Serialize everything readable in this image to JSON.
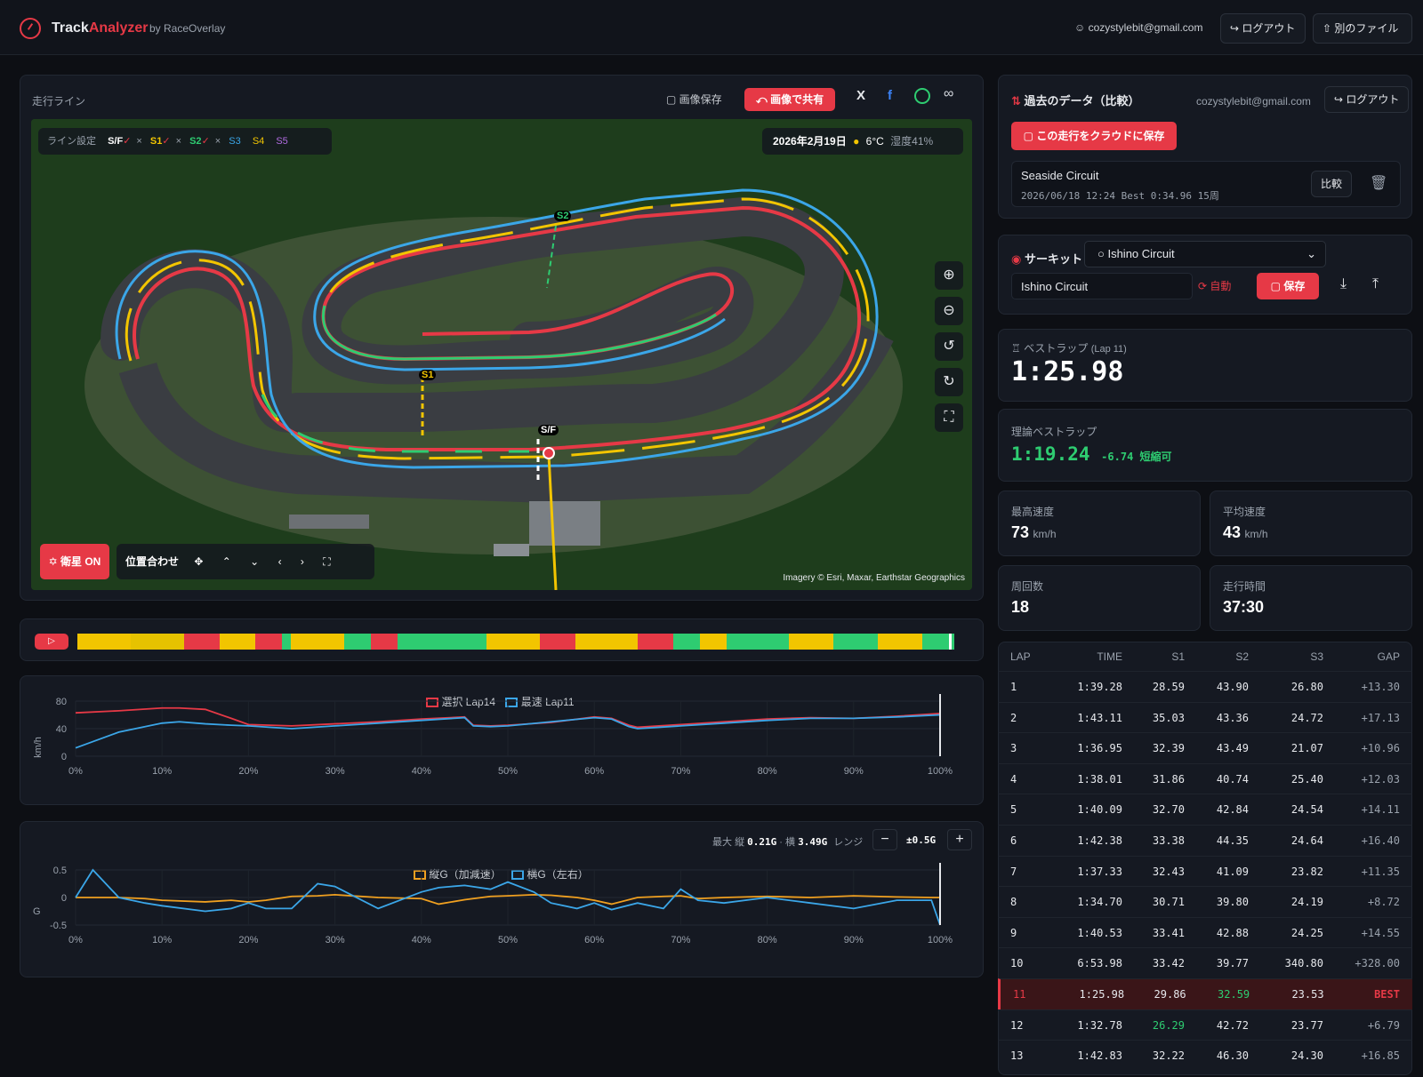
{
  "header": {
    "brand_a": "Track",
    "brand_b": "Analyzer",
    "by": "by RaceOverlay",
    "user": "cozystylebit@gmail.com",
    "logout": "ログアウト",
    "other_file": "別のファイル"
  },
  "map_panel": {
    "title": "走行ライン",
    "save_image": "画像保存",
    "share_image": "画像で共有",
    "line_settings": "ライン設定",
    "lines": [
      "S/F",
      "S1",
      "S2",
      "S3",
      "S4",
      "S5"
    ],
    "date": "2026年2月19日",
    "temp": "6°C",
    "humidity": "湿度41%",
    "sector_labels": [
      "S1",
      "S2",
      "S/F"
    ],
    "satellite": "衛星 ON",
    "align": "位置合わせ",
    "attribution": "Imagery © Esri, Maxar, Earthstar Geographics"
  },
  "speed_chart": {
    "legend_a": "選択 Lap14",
    "legend_b": "最速 Lap11",
    "ylabel": "km/h",
    "yticks": [
      "80",
      "40",
      "0"
    ],
    "xticks": [
      "0%",
      "10%",
      "20%",
      "30%",
      "40%",
      "50%",
      "60%",
      "70%",
      "80%",
      "90%",
      "100%"
    ]
  },
  "g_chart": {
    "max_label": "最大",
    "max_long_label": "縦",
    "max_long": "0.21G",
    "max_lat_label": "横",
    "max_lat": "3.49G",
    "range_label": "レンジ",
    "range": "±0.5G",
    "legend_a": "縦G（加減速）",
    "legend_b": "横G（左右）",
    "ylabel": "G",
    "yticks": [
      "0.5",
      "0",
      "-0.5"
    ],
    "xticks": [
      "0%",
      "10%",
      "20%",
      "30%",
      "40%",
      "50%",
      "60%",
      "70%",
      "80%",
      "90%",
      "100%"
    ]
  },
  "past": {
    "title": "過去のデータ（比較）",
    "user": "cozystylebit@gmail.com",
    "logout": "ログアウト",
    "save_cloud": "この走行をクラウドに保存",
    "entry_name": "Seaside Circuit",
    "entry_meta": "2026/06/18 12:24  Best 0:34.96  15周",
    "compare": "比較"
  },
  "circuit": {
    "label": "サーキット",
    "selected": "Ishino Circuit",
    "name_value": "Ishino Circuit",
    "auto": "自動",
    "save": "保存"
  },
  "best_lap": {
    "label": "ベストラップ",
    "sub": "(Lap 11)",
    "value": "1:25.98"
  },
  "theory": {
    "label": "理論ベストラップ",
    "value": "1:19.24",
    "delta": "-6.74 短縮可"
  },
  "stats": {
    "top_speed_label": "最高速度",
    "top_speed": "73",
    "top_speed_unit": "km/h",
    "avg_speed_label": "平均速度",
    "avg_speed": "43",
    "avg_speed_unit": "km/h",
    "laps_label": "周回数",
    "laps": "18",
    "time_label": "走行時間",
    "time": "37:30"
  },
  "laps_table": {
    "headers": [
      "LAP",
      "TIME",
      "S1",
      "S2",
      "S3",
      "GAP"
    ],
    "rows": [
      [
        "1",
        "1:39.28",
        "28.59",
        "43.90",
        "26.80",
        "+13.30"
      ],
      [
        "2",
        "1:43.11",
        "35.03",
        "43.36",
        "24.72",
        "+17.13"
      ],
      [
        "3",
        "1:36.95",
        "32.39",
        "43.49",
        "21.07",
        "+10.96"
      ],
      [
        "4",
        "1:38.01",
        "31.86",
        "40.74",
        "25.40",
        "+12.03"
      ],
      [
        "5",
        "1:40.09",
        "32.70",
        "42.84",
        "24.54",
        "+14.11"
      ],
      [
        "6",
        "1:42.38",
        "33.38",
        "44.35",
        "24.64",
        "+16.40"
      ],
      [
        "7",
        "1:37.33",
        "32.43",
        "41.09",
        "23.82",
        "+11.35"
      ],
      [
        "8",
        "1:34.70",
        "30.71",
        "39.80",
        "24.19",
        "+8.72"
      ],
      [
        "9",
        "1:40.53",
        "33.41",
        "42.88",
        "24.25",
        "+14.55"
      ],
      [
        "10",
        "6:53.98",
        "33.42",
        "39.77",
        "340.80",
        "+328.00"
      ],
      [
        "11",
        "1:25.98",
        "29.86",
        "32.59",
        "23.53",
        "BEST"
      ],
      [
        "12",
        "1:32.78",
        "26.29",
        "42.72",
        "23.77",
        "+6.79"
      ],
      [
        "13",
        "1:42.83",
        "32.22",
        "46.30",
        "24.30",
        "+16.85"
      ]
    ]
  },
  "chart_data": [
    {
      "type": "line",
      "x": [
        0,
        5,
        10,
        12,
        15,
        18,
        20,
        25,
        30,
        35,
        40,
        45,
        46,
        48,
        50,
        55,
        60,
        62,
        64,
        65,
        70,
        75,
        80,
        85,
        90,
        95,
        100
      ],
      "series": [
        {
          "name": "選択 Lap14",
          "values": [
            63,
            66,
            70,
            70,
            68,
            55,
            46,
            44,
            47,
            50,
            54,
            57,
            45,
            44,
            45,
            49,
            57,
            55,
            45,
            42,
            46,
            50,
            54,
            56,
            55,
            58,
            62
          ]
        },
        {
          "name": "最速 Lap11",
          "values": [
            12,
            35,
            48,
            50,
            47,
            45,
            44,
            40,
            44,
            48,
            52,
            56,
            44,
            43,
            44,
            50,
            56,
            54,
            43,
            40,
            44,
            48,
            52,
            55,
            55,
            57,
            60
          ]
        }
      ],
      "ylim": [
        0,
        80
      ],
      "ylabel": "km/h"
    },
    {
      "type": "line",
      "x": [
        0,
        2,
        5,
        8,
        10,
        15,
        18,
        20,
        22,
        25,
        28,
        30,
        35,
        40,
        42,
        45,
        48,
        50,
        53,
        55,
        58,
        60,
        62,
        65,
        68,
        70,
        72,
        75,
        80,
        85,
        90,
        95,
        99,
        100
      ],
      "series": [
        {
          "name": "縦G（加減速）",
          "values": [
            0,
            0,
            0,
            -0.02,
            -0.05,
            -0.08,
            -0.05,
            -0.08,
            -0.05,
            0.02,
            0.03,
            0.05,
            0.0,
            -0.02,
            -0.12,
            -0.04,
            0.02,
            0.03,
            0.05,
            0.04,
            0.0,
            -0.05,
            -0.12,
            0.0,
            0.02,
            0.03,
            -0.02,
            0.0,
            0.02,
            0.0,
            0.03,
            0.01,
            0.0,
            0.0
          ]
        },
        {
          "name": "横G（左右）",
          "values": [
            0,
            0.5,
            0,
            -0.1,
            -0.15,
            -0.25,
            -0.2,
            -0.1,
            -0.2,
            -0.2,
            0.25,
            0.2,
            -0.2,
            0.1,
            0.18,
            0.22,
            0.15,
            0.28,
            0.1,
            -0.1,
            -0.2,
            -0.1,
            -0.22,
            -0.1,
            -0.2,
            0.15,
            -0.05,
            -0.1,
            0.0,
            -0.1,
            -0.2,
            -0.05,
            -0.05,
            -0.5
          ]
        }
      ],
      "ylim": [
        -0.5,
        0.5
      ],
      "ylabel": "G"
    }
  ]
}
